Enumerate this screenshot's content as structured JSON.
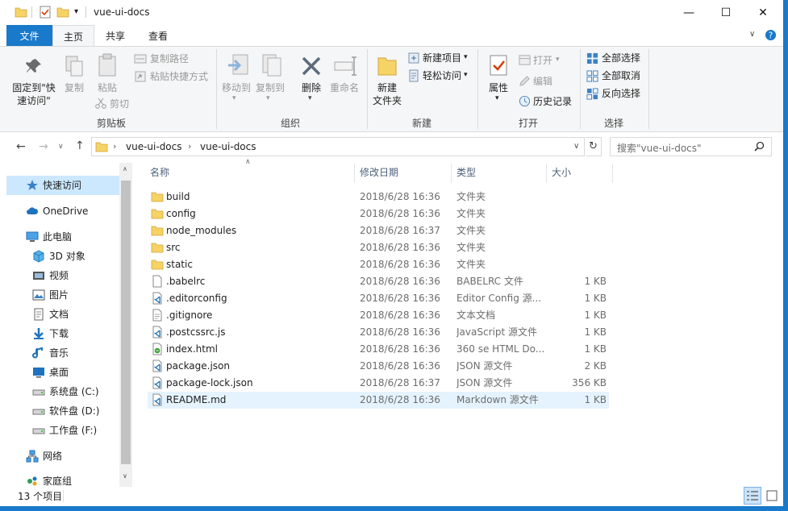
{
  "window": {
    "title": "vue-ui-docs",
    "minimize": "—",
    "maximize": "☐",
    "close": "✕",
    "accent_color": "#1979ca"
  },
  "ribbon_tabs": [
    "文件",
    "主页",
    "共享",
    "查看"
  ],
  "ribbon": {
    "clipboard": {
      "group_label": "剪贴板",
      "pin": "固定到\"快\n速访问\"",
      "copy": "复制",
      "paste": "粘贴",
      "copy_path": "复制路径",
      "paste_shortcut": "粘贴快捷方式",
      "cut": "剪切"
    },
    "organize": {
      "group_label": "组织",
      "move_to": "移动到",
      "copy_to": "复制到",
      "delete": "删除",
      "rename": "重命名"
    },
    "new": {
      "group_label": "新建",
      "new_folder": "新建\n文件夹",
      "new_item": "新建项目",
      "easy_access": "轻松访问"
    },
    "open": {
      "group_label": "打开",
      "properties": "属性",
      "open": "打开",
      "edit": "编辑",
      "history": "历史记录"
    },
    "select": {
      "group_label": "选择",
      "select_all": "全部选择",
      "select_none": "全部取消",
      "invert": "反向选择"
    }
  },
  "address": {
    "crumbs": [
      "vue-ui-docs",
      "vue-ui-docs"
    ],
    "search_placeholder": "搜索\"vue-ui-docs\""
  },
  "nav": [
    {
      "label": "快速访问",
      "icon": "star-icon",
      "indent": 0,
      "selected": true
    },
    {
      "label": "OneDrive",
      "icon": "cloud-icon",
      "indent": 0
    },
    {
      "label": "此电脑",
      "icon": "pc-icon",
      "indent": 0
    },
    {
      "label": "3D 对象",
      "icon": "cube-icon",
      "indent": 1
    },
    {
      "label": "视频",
      "icon": "video-icon",
      "indent": 1
    },
    {
      "label": "图片",
      "icon": "picture-icon",
      "indent": 1
    },
    {
      "label": "文档",
      "icon": "document-icon",
      "indent": 1
    },
    {
      "label": "下载",
      "icon": "download-icon",
      "indent": 1
    },
    {
      "label": "音乐",
      "icon": "music-icon",
      "indent": 1
    },
    {
      "label": "桌面",
      "icon": "desktop-icon",
      "indent": 1
    },
    {
      "label": "系统盘 (C:)",
      "icon": "drive-icon",
      "indent": 1
    },
    {
      "label": "软件盘 (D:)",
      "icon": "drive-icon",
      "indent": 1
    },
    {
      "label": "工作盘 (F:)",
      "icon": "drive-icon",
      "indent": 1
    },
    {
      "label": "网络",
      "icon": "network-icon",
      "indent": 0
    },
    {
      "label": "家庭组",
      "icon": "homegroup-icon",
      "indent": 0
    }
  ],
  "columns": [
    "名称",
    "修改日期",
    "类型",
    "大小"
  ],
  "files": [
    {
      "name": "build",
      "date": "2018/6/28 16:36",
      "type": "文件夹",
      "size": "",
      "icon": "folder-icon"
    },
    {
      "name": "config",
      "date": "2018/6/28 16:36",
      "type": "文件夹",
      "size": "",
      "icon": "folder-icon"
    },
    {
      "name": "node_modules",
      "date": "2018/6/28 16:37",
      "type": "文件夹",
      "size": "",
      "icon": "folder-icon"
    },
    {
      "name": "src",
      "date": "2018/6/28 16:36",
      "type": "文件夹",
      "size": "",
      "icon": "folder-icon"
    },
    {
      "name": "static",
      "date": "2018/6/28 16:36",
      "type": "文件夹",
      "size": "",
      "icon": "folder-icon"
    },
    {
      "name": ".babelrc",
      "date": "2018/6/28 16:36",
      "type": "BABELRC 文件",
      "size": "1 KB",
      "icon": "file-icon"
    },
    {
      "name": ".editorconfig",
      "date": "2018/6/28 16:36",
      "type": "Editor Config 源...",
      "size": "1 KB",
      "icon": "vscode-file-icon"
    },
    {
      "name": ".gitignore",
      "date": "2018/6/28 16:36",
      "type": "文本文档",
      "size": "1 KB",
      "icon": "text-file-icon"
    },
    {
      "name": ".postcssrc.js",
      "date": "2018/6/28 16:36",
      "type": "JavaScript 源文件",
      "size": "1 KB",
      "icon": "vscode-file-icon"
    },
    {
      "name": "index.html",
      "date": "2018/6/28 16:36",
      "type": "360 se HTML Do...",
      "size": "1 KB",
      "icon": "html-file-icon"
    },
    {
      "name": "package.json",
      "date": "2018/6/28 16:36",
      "type": "JSON 源文件",
      "size": "2 KB",
      "icon": "vscode-file-icon"
    },
    {
      "name": "package-lock.json",
      "date": "2018/6/28 16:37",
      "type": "JSON 源文件",
      "size": "356 KB",
      "icon": "vscode-file-icon"
    },
    {
      "name": "README.md",
      "date": "2018/6/28 16:36",
      "type": "Markdown 源文件",
      "size": "1 KB",
      "icon": "vscode-file-icon",
      "selected": true
    }
  ],
  "status": {
    "count": "13 个项目"
  }
}
